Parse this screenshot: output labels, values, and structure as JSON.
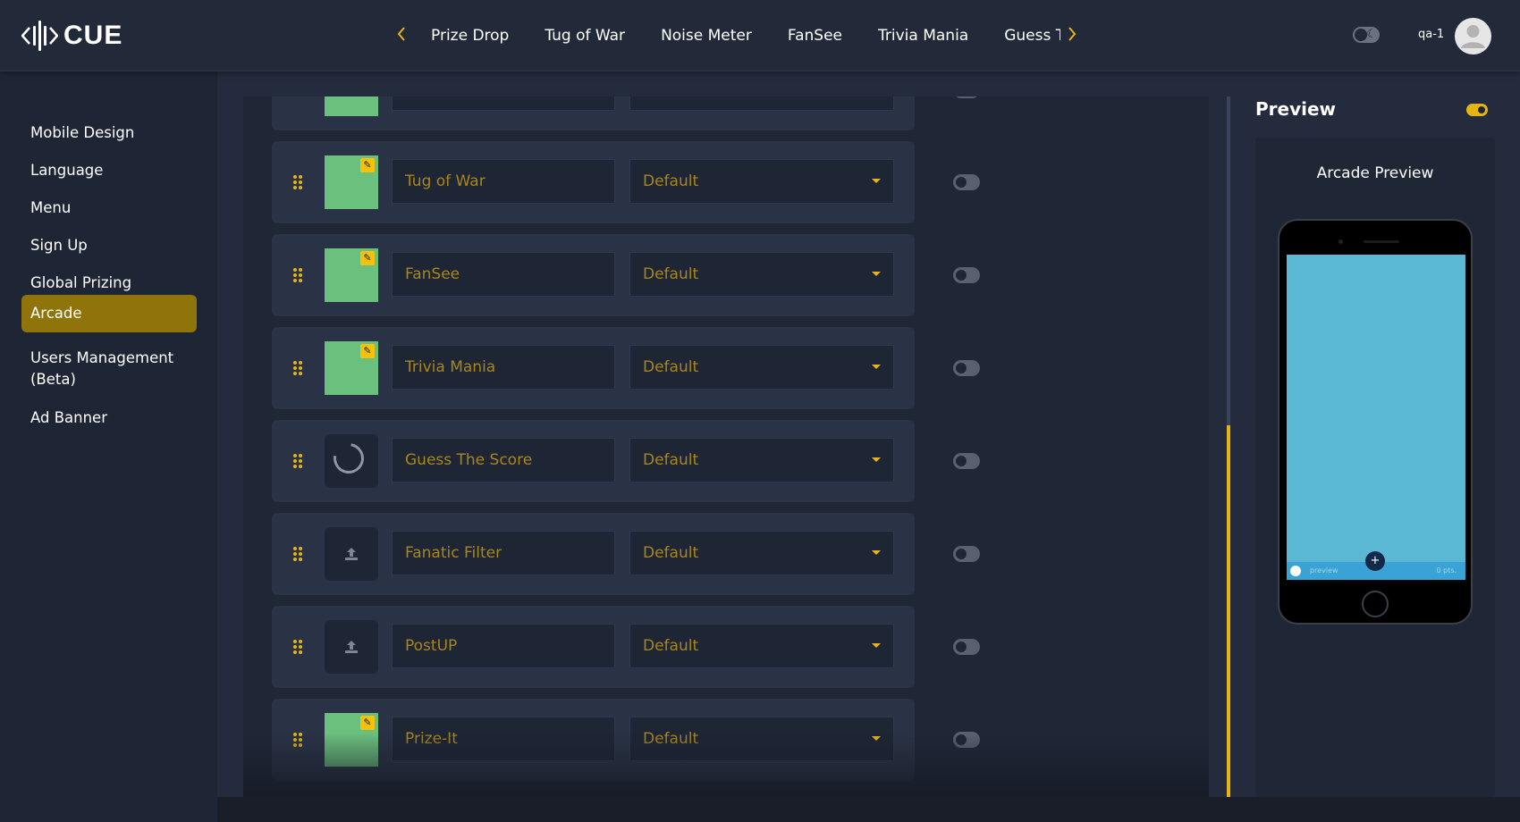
{
  "brand": {
    "name": "CUE"
  },
  "topnav": {
    "prev_icon": "chevron-left-icon",
    "next_icon": "chevron-right-icon",
    "tabs": [
      "Prize Drop",
      "Tug of War",
      "Noise Meter",
      "FanSee",
      "Trivia Mania",
      "Guess The Score"
    ]
  },
  "user": {
    "name": "qa-1"
  },
  "sidebar": {
    "items": [
      {
        "label": "Mobile Design",
        "active": false
      },
      {
        "label": "Language",
        "active": false
      },
      {
        "label": "Menu",
        "active": false
      },
      {
        "label": "Sign Up",
        "active": false
      },
      {
        "label": "Global Prizing",
        "active": false
      },
      {
        "label": "Arcade",
        "active": true
      },
      {
        "label": "Users Management (Beta)",
        "active": false
      },
      {
        "label": "Ad Banner",
        "active": false
      }
    ]
  },
  "games": [
    {
      "name": "Tug of War",
      "mode": "Default",
      "thumbnail": "green-image",
      "enabled": false
    },
    {
      "name": "FanSee",
      "mode": "Default",
      "thumbnail": "green-image",
      "enabled": false
    },
    {
      "name": "Trivia Mania",
      "mode": "Default",
      "thumbnail": "green-image",
      "enabled": false
    },
    {
      "name": "Guess The Score",
      "mode": "Default",
      "thumbnail": "loading-spinner",
      "enabled": false
    },
    {
      "name": "Fanatic Filter",
      "mode": "Default",
      "thumbnail": "upload",
      "enabled": false
    },
    {
      "name": "PostUP",
      "mode": "Default",
      "thumbnail": "upload",
      "enabled": false
    },
    {
      "name": "Prize-It",
      "mode": "Default",
      "thumbnail": "green-image",
      "enabled": false
    }
  ],
  "preview": {
    "title": "Preview",
    "card_title": "Arcade Preview",
    "enabled": true,
    "screen": {
      "label": "preview",
      "points": "0 pts."
    }
  },
  "colors": {
    "accent": "#e7b416",
    "active_nav": "#8e740a",
    "background": "#1f2738",
    "thumbnail_green": "#6cc07e",
    "phone_screen": "#5bb8d4"
  }
}
